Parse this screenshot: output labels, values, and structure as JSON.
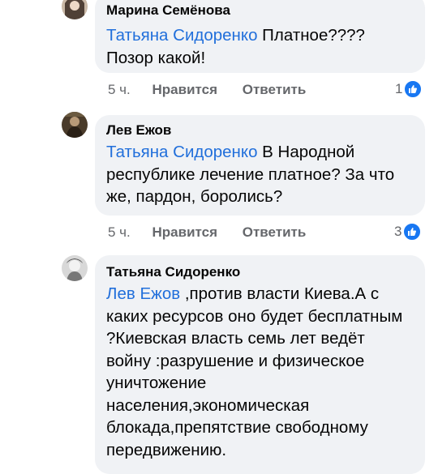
{
  "comments": [
    {
      "author": "Марина Семёнова",
      "mention": "Татьяна Сидоренко",
      "text": " Платное???? Позор какой!",
      "time": "5 ч.",
      "like_label": "Нравится",
      "reply_label": "Ответить",
      "reactions": "1"
    },
    {
      "author": "Лев Ежов",
      "mention": "Татьяна Сидоренко",
      "text": "  В Народной республике лечение платное? За что же, пардон, боролись?",
      "time": "5 ч.",
      "like_label": "Нравится",
      "reply_label": "Ответить",
      "reactions": "3"
    },
    {
      "author": "Татьяна Сидоренко",
      "mention": "Лев Ежов",
      "text": " ,против власти Киева.А с каких ресурсов оно будет бесплатным ?Киевская власть семь лет ведёт войну :разрушение и физическое уничтожение населения,экономическая блокада,препятствие свободному передвижению."
    }
  ],
  "icons": {
    "reaction": "like-thumb-icon"
  },
  "colors": {
    "mention": "#216fdb",
    "bubble": "#f0f2f5",
    "like": "#1877f2",
    "meta": "#65676b"
  }
}
